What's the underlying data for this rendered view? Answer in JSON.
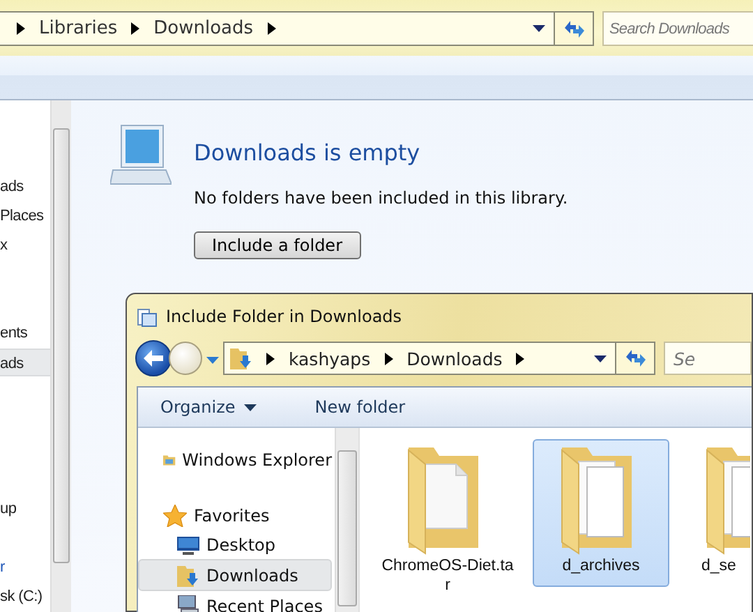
{
  "address_bar": {
    "crumbs": [
      "Libraries",
      "Downloads"
    ],
    "search": {
      "placeholder": "Search Downloads"
    }
  },
  "nav_pane": {
    "items": [
      {
        "label": "ads",
        "kind": "item",
        "selected": false
      },
      {
        "label": "Places",
        "kind": "item",
        "selected": false
      },
      {
        "label": "x",
        "kind": "item",
        "selected": false
      },
      {
        "label": "ents",
        "kind": "item",
        "selected": false
      },
      {
        "label": "ads",
        "kind": "item",
        "selected": true
      },
      {
        "label": "up",
        "kind": "item",
        "selected": false
      },
      {
        "label": "r",
        "kind": "header",
        "selected": false
      },
      {
        "label": "sk (C:)",
        "kind": "item",
        "selected": false
      }
    ]
  },
  "library": {
    "title": "Downloads is empty",
    "message": "No folders have been included in this library.",
    "button": "Include a folder"
  },
  "dialog": {
    "title": "Include Folder in Downloads",
    "crumbs": [
      "kashyaps",
      "Downloads"
    ],
    "search": {
      "placeholder": "Se"
    },
    "toolbar": [
      {
        "label": "Organize",
        "kind": "menu"
      },
      {
        "label": "New folder",
        "kind": "button"
      }
    ],
    "nav": [
      {
        "label": "Windows Explorer",
        "kind": "explorer",
        "selected": false
      },
      {
        "label": "Favorites",
        "kind": "star",
        "selected": false,
        "children": [
          {
            "label": "Desktop",
            "kind": "desktop",
            "selected": false
          },
          {
            "label": "Downloads",
            "kind": "downloads",
            "selected": true
          },
          {
            "label": "Recent Places",
            "kind": "recent",
            "selected": false
          }
        ]
      }
    ],
    "files": [
      {
        "name": "ChromeOS-Diet.ta",
        "name_line_2": "r",
        "kind": "document",
        "selected": false
      },
      {
        "name": "d_archives",
        "kind": "papers",
        "selected": true
      },
      {
        "name": "d_se",
        "kind": "papers",
        "selected": false
      }
    ]
  }
}
